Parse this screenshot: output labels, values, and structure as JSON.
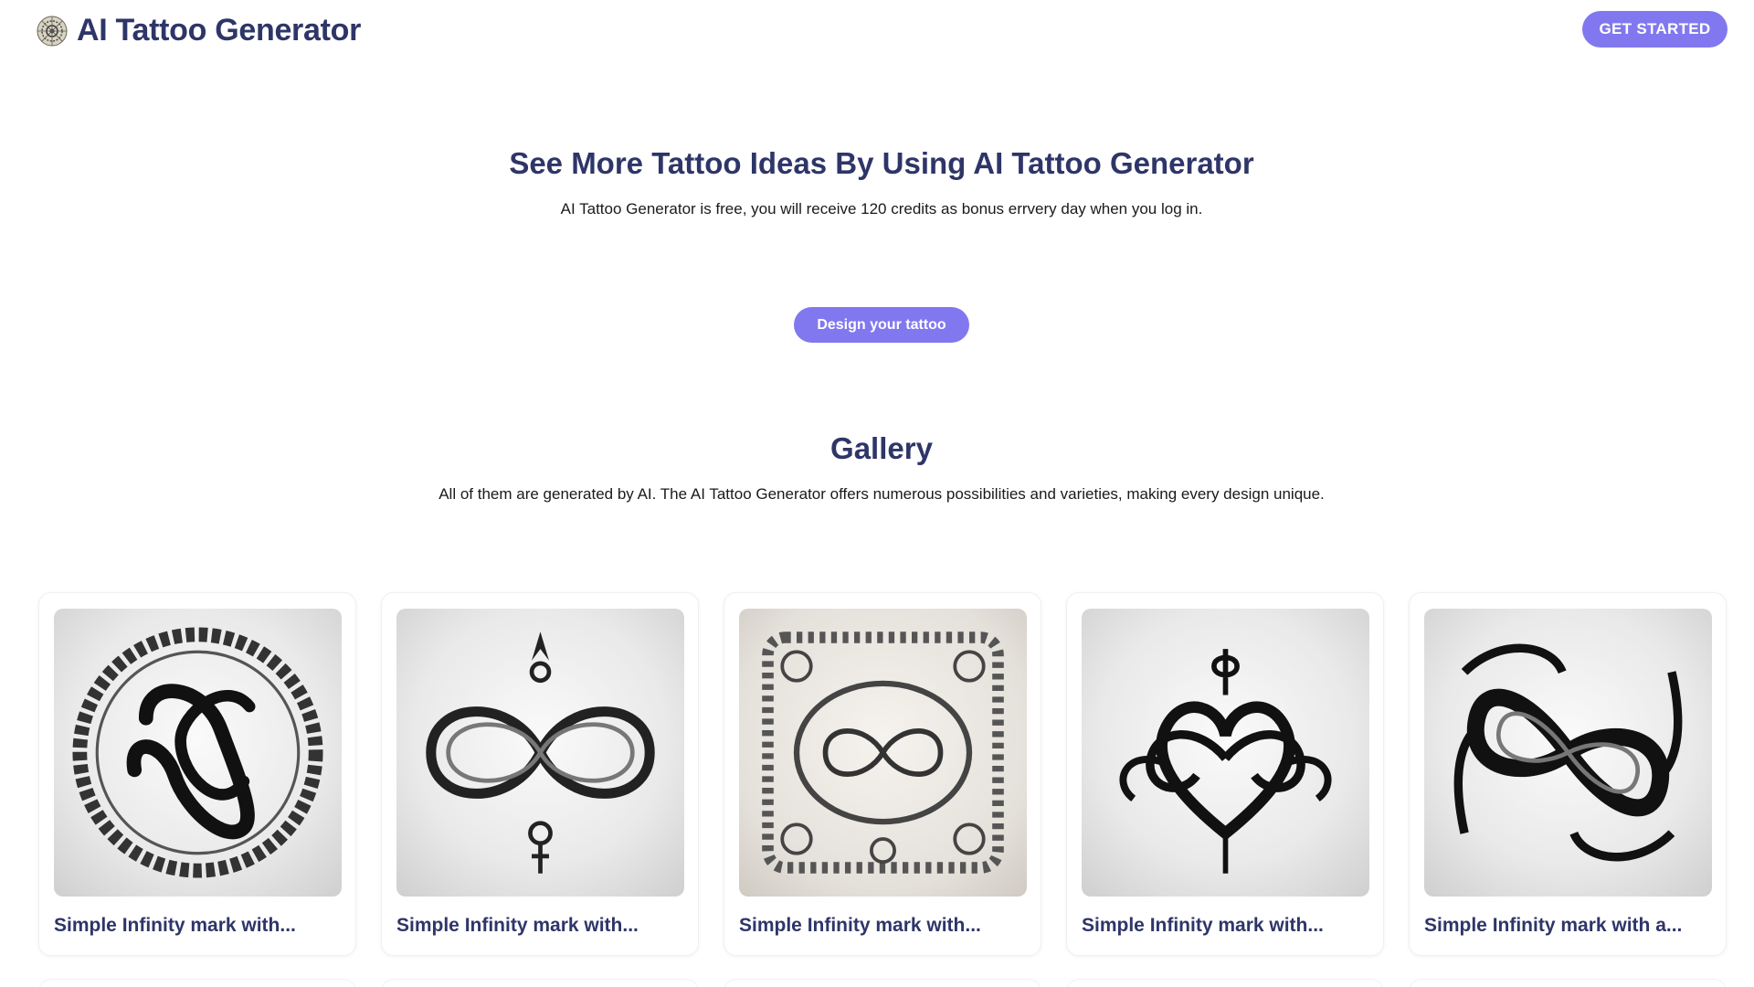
{
  "header": {
    "app_title": "AI Tattoo Generator",
    "logo_icon": "mandala-logo-icon",
    "cta_label": "GET STARTED"
  },
  "hero": {
    "title": "See More Tattoo Ideas By Using AI Tattoo Generator",
    "subtitle": "AI Tattoo Generator is free, you will receive 120 credits as bonus errvery day when you log in.",
    "button_label": "Design your tattoo"
  },
  "gallery": {
    "title": "Gallery",
    "subtitle": "All of them are generated by AI. The AI Tattoo Generator offers numerous possibilities and varieties, making every design unique.",
    "items": [
      {
        "caption": "Simple Infinity mark with...",
        "image": "celtic-ring-infinity-image"
      },
      {
        "caption": "Simple Infinity mark with...",
        "image": "ribbon-infinity-image"
      },
      {
        "caption": "Simple Infinity mark with...",
        "image": "floral-frame-infinity-image"
      },
      {
        "caption": "Simple Infinity mark with...",
        "image": "heart-infinity-image"
      },
      {
        "caption": "Simple Infinity mark with a...",
        "image": "tribal-infinity-image"
      }
    ]
  },
  "colors": {
    "brand_navy": "#2e3568",
    "button_purple": "#8178f0"
  }
}
